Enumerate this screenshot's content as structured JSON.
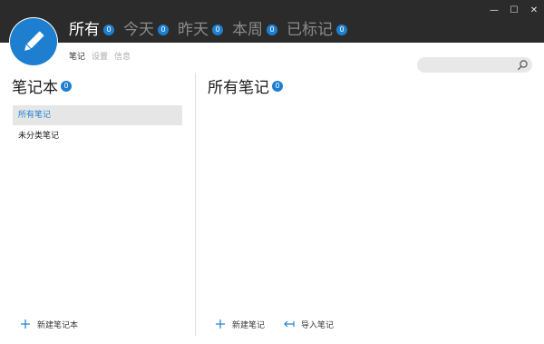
{
  "app": {
    "brand_color": "#1e7fd0",
    "logo_icon": "pencil-icon"
  },
  "window_controls": [
    {
      "name": "minimize-button",
      "glyph": "—"
    },
    {
      "name": "maximize-button",
      "glyph": "☐"
    },
    {
      "name": "close-button",
      "glyph": "✕"
    }
  ],
  "filter_tabs": [
    {
      "label": "所有",
      "count": "0",
      "active": true
    },
    {
      "label": "今天",
      "count": "0",
      "active": false
    },
    {
      "label": "昨天",
      "count": "0",
      "active": false
    },
    {
      "label": "本周",
      "count": "0",
      "active": false
    },
    {
      "label": "已标记",
      "count": "0",
      "active": false
    }
  ],
  "sub_tabs": [
    {
      "label": "笔记",
      "active": true
    },
    {
      "label": "设置",
      "active": false
    },
    {
      "label": "信息",
      "active": false
    }
  ],
  "search": {
    "placeholder": "",
    "icon": "search-icon"
  },
  "notebooks": {
    "title": "笔记本",
    "count": "0",
    "items": [
      {
        "label": "所有笔记",
        "selected": true
      },
      {
        "label": "未分类笔记",
        "selected": false
      }
    ],
    "new_button": "新建笔记本"
  },
  "notes": {
    "title": "所有笔记",
    "count": "0",
    "new_button": "新建笔记",
    "import_button": "导入笔记"
  }
}
